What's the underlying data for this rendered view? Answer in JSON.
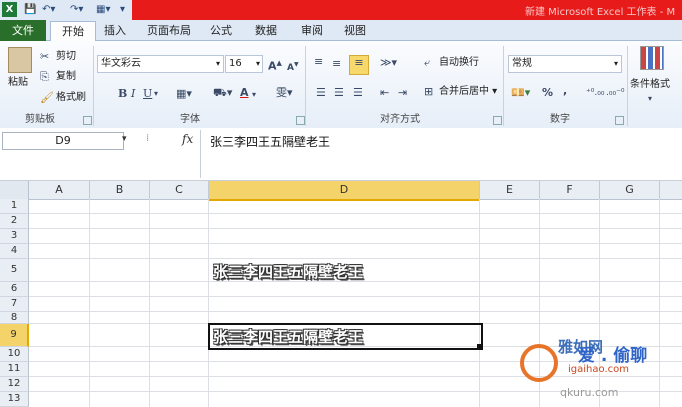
{
  "app": {
    "doc_title": "新建 Microsoft Excel 工作表 - M",
    "excel_icon": "excel-icon"
  },
  "tabs": [
    "文件",
    "开始",
    "插入",
    "页面布局",
    "公式",
    "数据",
    "审阅",
    "视图"
  ],
  "clipboard": {
    "paste": "粘贴",
    "cut": "剪切",
    "copy": "复制",
    "format_painter": "格式刷",
    "label": "剪贴板"
  },
  "font": {
    "name": "华文彩云",
    "size": "16",
    "label": "字体",
    "bold": "B",
    "italic": "I",
    "underline": "U",
    "color_letter": "A",
    "phonetic": "雯",
    "grow": "A",
    "shrink": "A"
  },
  "alignment": {
    "wrap": "自动换行",
    "merge": "合并后居中",
    "label": "对齐方式"
  },
  "number": {
    "format": "常规",
    "percent": "%",
    "comma": ",",
    "label": "数字"
  },
  "styles": {
    "conditional": "条件格式"
  },
  "formula_bar": {
    "name_box": "D9",
    "fx": "fx",
    "content": "张三李四王五隔壁老王"
  },
  "sheet": {
    "columns": [
      "A",
      "B",
      "C",
      "D",
      "E",
      "F",
      "G"
    ],
    "rows": [
      "1",
      "2",
      "3",
      "4",
      "5",
      "6",
      "7",
      "8",
      "9",
      "10",
      "11",
      "12",
      "13"
    ],
    "cell_d5": "张三李四王五隔壁老王",
    "cell_d9": "张三李四王五隔壁老王",
    "selected_column": "D",
    "selected_row": "9"
  },
  "watermark": {
    "top": "雅如网",
    "mid": "爱 . 偷聊",
    "url": "igaihao.com",
    "bottom": "qkuru.com"
  },
  "colors": {
    "file_tab": "#2a6e2b",
    "title_red": "#e81b1b",
    "selected_header": "#f5d36b"
  }
}
